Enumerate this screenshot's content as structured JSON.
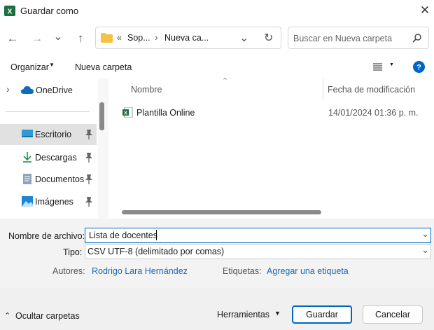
{
  "window": {
    "title": "Guardar como",
    "app_icon": "excel-icon"
  },
  "nav": {
    "back": "←",
    "forward": "→",
    "recent": "⌄",
    "up": "↑",
    "breadcrumb": {
      "prefix": "«",
      "items": [
        "Sop...",
        "Nueva ca..."
      ]
    },
    "search_placeholder": "Buscar en Nueva carpeta"
  },
  "toolbar": {
    "organize_label": "Organizar",
    "new_folder_label": "Nueva carpeta"
  },
  "sidebar": {
    "items": [
      {
        "label": "OneDrive",
        "icon": "cloud-icon"
      },
      {
        "label": "Escritorio",
        "icon": "desktop-icon",
        "selected": true
      },
      {
        "label": "Descargas",
        "icon": "download-icon"
      },
      {
        "label": "Documentos",
        "icon": "documents-icon"
      },
      {
        "label": "Imágenes",
        "icon": "images-icon"
      }
    ]
  },
  "files": {
    "columns": [
      "Nombre",
      "Fecha de modificación"
    ],
    "rows": [
      {
        "name": "Plantilla Online",
        "modified": "14/01/2024 01:36 p. m."
      }
    ]
  },
  "form": {
    "filename_label": "Nombre de archivo:",
    "filename_value": "Lista de docentes",
    "type_label": "Tipo:",
    "type_value": "CSV UTF-8 (delimitado por comas)",
    "authors_label": "Autores:",
    "authors_value": "Rodrigo Lara Hernández",
    "tags_label": "Etiquetas:",
    "tags_value": "Agregar una etiqueta"
  },
  "footer": {
    "hide_folders_label": "Ocultar carpetas",
    "tools_label": "Herramientas",
    "save_label": "Guardar",
    "cancel_label": "Cancelar"
  },
  "colors": {
    "accent": "#0067c0",
    "link": "#1f67b1",
    "excel_green": "#1d6f42"
  }
}
